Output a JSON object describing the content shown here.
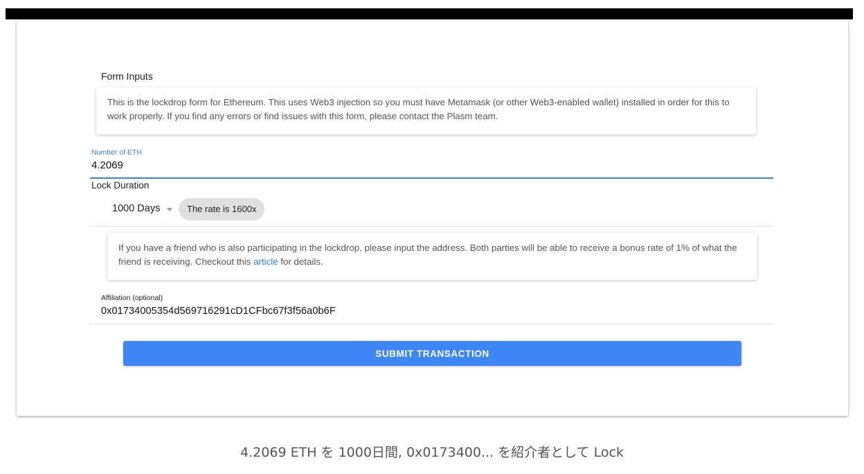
{
  "form": {
    "section_title": "Form Inputs",
    "intro_text": "This is the lockdrop form for Ethereum. This uses Web3 injection so you must have Metamask (or other Web3-enabled wallet) installed in order for this to work properly. If you find any errors or find issues with this form, please contact the Plasm team.",
    "eth_field": {
      "label": "Number of ETH",
      "value": "4.2069"
    },
    "lock_duration": {
      "label": "Lock Duration",
      "selected": "1000 Days",
      "rate_chip": "The rate is 1600x"
    },
    "affiliation_info": {
      "text_before_link": "If you have a friend who is also participating in the lockdrop, please input the address. Both parties will be able to receive a bonus rate of 1% of what the friend is receiving. Checkout this ",
      "link_text": "article",
      "text_after_link": " for details."
    },
    "affiliation_field": {
      "label": "Affiliation (optional)",
      "value": "0x01734005354d569716291cD1CFbc67f3f56a0b6F"
    },
    "submit_label": "SUBMIT TRANSACTION"
  },
  "caption": "4.2069 ETH を 1000日間, 0x0173400... を紹介者として Lock",
  "colors": {
    "accent": "#3b7ed6",
    "button": "#3f86f5",
    "chip": "#e0e0e0",
    "link": "#2f7bd8"
  }
}
